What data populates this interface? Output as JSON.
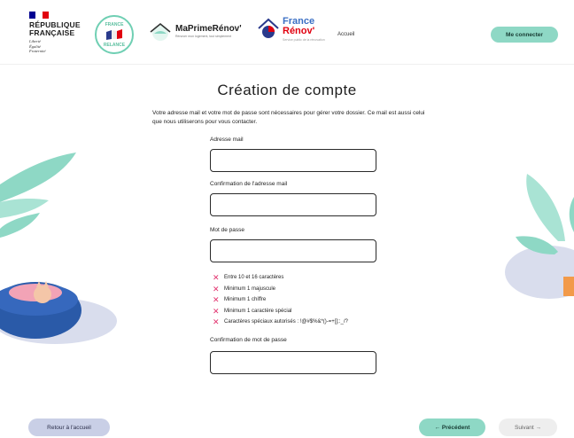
{
  "header": {
    "rf_lines": [
      "RÉPUBLIQUE",
      "FRANÇAISE"
    ],
    "rf_motto": [
      "Liberté",
      "Égalité",
      "Fraternité"
    ],
    "relance_top": "FRANCE",
    "relance_bottom": "RELANCE",
    "mpr_name": "MaPrimeRénov'",
    "mpr_sub": "Rénover mon logement, tout simplement",
    "fr_name_1": "France",
    "fr_name_2": "Rénov'",
    "fr_sub": "Service public de la rénovation",
    "nav_accueil": "Accueil",
    "connect_label": "Me connecter"
  },
  "form": {
    "title": "Création de compte",
    "intro": "Votre adresse mail et votre mot de passe sont nécessaires pour gérer votre dossier. Ce mail est aussi celui que nous utiliserons pour vous contacter.",
    "email_label": "Adresse mail",
    "email_value": "",
    "email_confirm_label": "Confirmation de l'adresse mail",
    "email_confirm_value": "",
    "password_label": "Mot de passe",
    "password_value": "",
    "password_rules": [
      "Entre 10 et 16 caractères",
      "Minimum 1 majuscule",
      "Minimum 1 chiffre",
      "Minimum 1 caractère spécial",
      "Caractères spéciaux autorisés : !@#$%&*()-=+[];:_/?"
    ],
    "password_confirm_label": "Confirmation de mot de passe",
    "password_confirm_value": ""
  },
  "footer": {
    "back_label": "Retour à l'accueil",
    "prev_label": "← Précédent",
    "next_label": "Suivant →"
  },
  "colors": {
    "accent": "#8ed8c5",
    "error": "#e1306c",
    "flag_blue": "#000091",
    "flag_red": "#e1000f"
  }
}
